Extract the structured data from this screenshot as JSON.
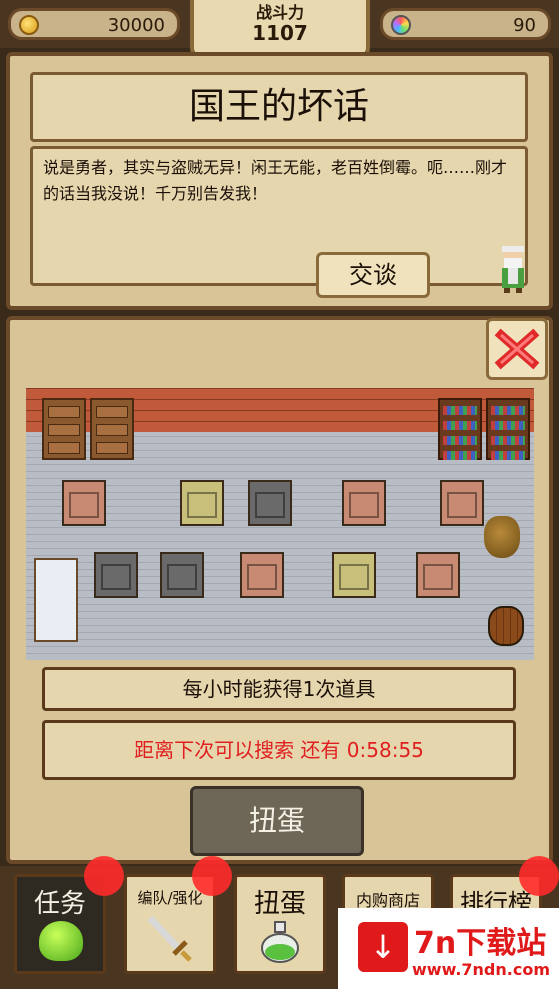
{
  "topbar": {
    "coins": "30000",
    "power_label": "战斗力",
    "power_value": "1107",
    "gems": "90"
  },
  "dialog": {
    "title": "国王的坏话",
    "text": "说是勇者，其实与盗贼无异！闲王无能，老百姓倒霉。呃……刚才的话当我没说！千万别告发我！",
    "talk_button": "交谈"
  },
  "search": {
    "info": "每小时能获得1次道具",
    "countdown_label": "距离下次可以搜索 还有",
    "countdown_value": "0:58:55",
    "gacha_button": "扭蛋"
  },
  "nav": {
    "tabs": [
      {
        "label": "任务"
      },
      {
        "label": "编队/强化"
      },
      {
        "label": "扭蛋"
      },
      {
        "label": "内购商店"
      },
      {
        "label": "排行榜"
      }
    ]
  },
  "watermark": {
    "brand": "7n下载站",
    "url": "www.7ndn.com"
  },
  "colors": {
    "countdown": "#e02020",
    "panel": "#d8c497",
    "border": "#6b4a2a"
  },
  "icons": [
    "coin-icon",
    "gem-icon",
    "close-icon",
    "slime-icon",
    "sword-icon",
    "potion-icon",
    "download-icon"
  ]
}
